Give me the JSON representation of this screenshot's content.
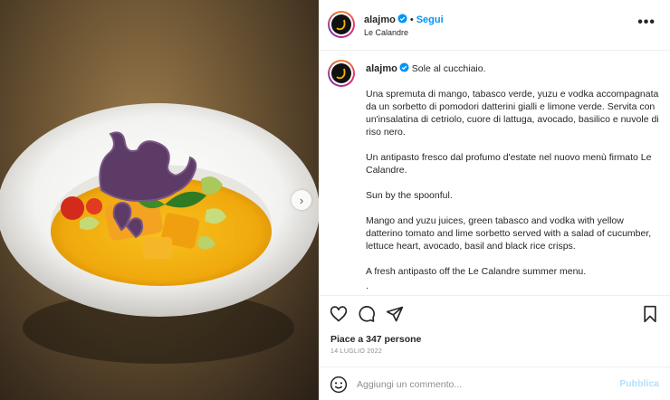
{
  "post": {
    "username": "alajmo",
    "follow_label": "Segui",
    "separator": "•",
    "location": "Le Calandre",
    "more_label": "•••",
    "next_label": "›"
  },
  "caption": {
    "username": "alajmo",
    "title": "Sole al cucchiaio.",
    "paragraphs": [
      "Una spremuta di mango, tabasco verde, yuzu e vodka accompagnata da un sorbetto di pomodori datterini gialli e limone verde. Servita con un'insalatina di cetriolo, cuore di lattuga, avocado, basilico e nuvole di riso nero.",
      "Un antipasto fresco dal profumo d'estate nel nuovo menù firmato Le Calandre.",
      "Sun by the spoonful.",
      "Mango and yuzu juices, green tabasco and vodka with yellow datterino tomato and lime sorbetto served with a salad of cucumber, lettuce heart, avocado, basil and black rice crisps.",
      "A fresh antipasto off the Le Calandre summer menu.",
      "."
    ]
  },
  "actions": {
    "likes": "Piace a 347 persone",
    "date": "14 LUGLIO 2022"
  },
  "comment": {
    "placeholder": "Aggiungi un commento...",
    "publish_label": "Pubblica"
  },
  "icons": [
    "heart-icon",
    "comment-icon",
    "share-icon",
    "bookmark-icon",
    "emoji-icon",
    "verified-icon"
  ],
  "colors": {
    "accent": "#0095f6",
    "publish_disabled": "#b3dffc",
    "text": "#262626",
    "muted": "#8e8e8e"
  }
}
